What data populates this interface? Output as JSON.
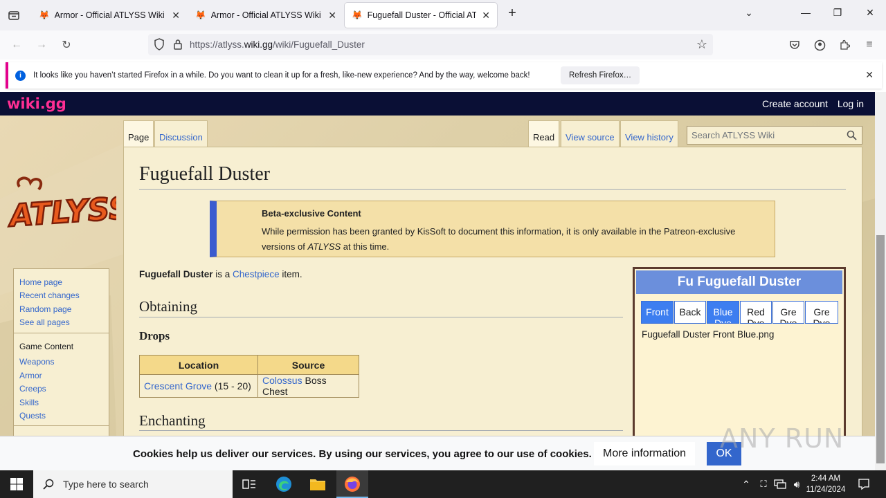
{
  "browser": {
    "tabs": [
      {
        "title": "Armor - Official ATLYSS Wiki",
        "active": false
      },
      {
        "title": "Armor - Official ATLYSS Wiki",
        "active": false
      },
      {
        "title": "Fuguefall Duster - Official ATLYSS Wiki",
        "active": true
      }
    ],
    "url_prefix": "https://atlyss.",
    "url_domain": "wiki.gg",
    "url_path": "/wiki/Fuguefall_Duster",
    "notification": {
      "message": "It looks like you haven’t started Firefox in a while. Do you want to clean it up for a fresh, like-new experience? And by the way, welcome back!",
      "button": "Refresh Firefox…"
    }
  },
  "wiki": {
    "logo": "wiki.gg",
    "create_account": "Create account",
    "log_in": "Log in"
  },
  "page_tabs": {
    "page": "Page",
    "discussion": "Discussion",
    "read": "Read",
    "view_source": "View source",
    "view_history": "View history"
  },
  "search": {
    "placeholder": "Search ATLYSS Wiki"
  },
  "sidebar": {
    "nav": [
      "Home page",
      "Recent changes",
      "Random page",
      "See all pages"
    ],
    "section_title": "Game Content",
    "section_items": [
      "Weapons",
      "Armor",
      "Creeps",
      "Skills",
      "Quests"
    ]
  },
  "article": {
    "title": "Fuguefall Duster",
    "beta_title": "Beta-exclusive Content",
    "beta_text_1": "While permission has been granted by KisSoft to document this information, it is only available in the Patreon-exclusive versions of ",
    "beta_game": "ATLYSS",
    "beta_text_2": " at this time.",
    "lead_bold": "Fuguefall Duster",
    "lead_mid": " is a ",
    "lead_link": "Chestpiece",
    "lead_end": " item.",
    "h_obtaining": "Obtaining",
    "h_drops": "Drops",
    "h_enchanting": "Enchanting",
    "drops_table": {
      "headers": [
        "Location",
        "Source"
      ],
      "row": {
        "location_link": "Crescent Grove",
        "location_extra": " (15 - 20)",
        "source_link": "Colossus",
        "source_extra": " Boss Chest"
      }
    }
  },
  "infobox": {
    "title_prefix": "Fu",
    "title": "Fuguefall Duster",
    "buttons": [
      "Front",
      "Back",
      "Blue Dye",
      "Red Dye",
      "Gre Dye",
      "Gre Dye"
    ],
    "filename": "Fuguefall Duster Front Blue.png"
  },
  "cookie": {
    "text": "Cookies help us deliver our services. By using our services, you agree to our use of cookies.",
    "more": "More information",
    "ok": "OK"
  },
  "watermark": "ANY RUN",
  "taskbar": {
    "search_placeholder": "Type here to search",
    "time": "2:44 AM",
    "date": "11/24/2024"
  }
}
